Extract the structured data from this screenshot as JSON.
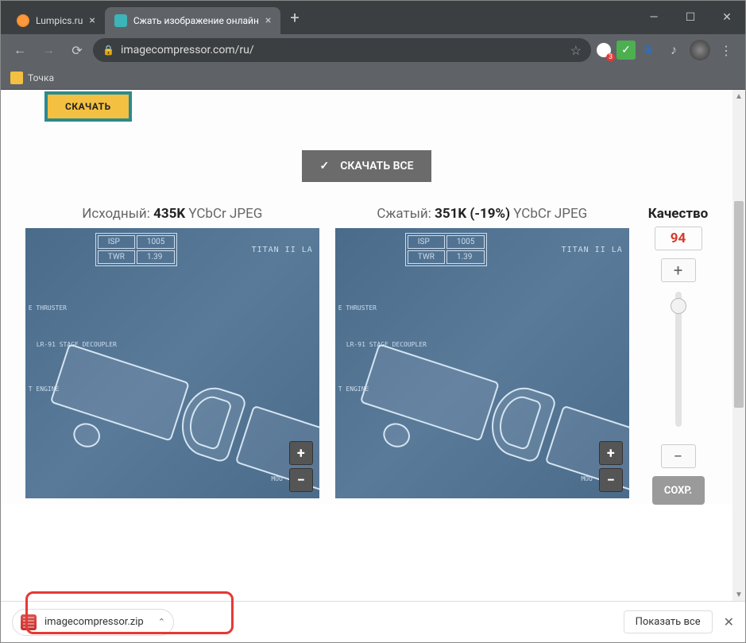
{
  "tabs": [
    {
      "title": "Lumpics.ru",
      "active": false
    },
    {
      "title": "Сжать изображение онлайн",
      "active": true
    }
  ],
  "address": {
    "url": "imagecompressor.com/ru/"
  },
  "bookmarks": [
    {
      "label": "Точка"
    }
  ],
  "page": {
    "download_single": "СКАЧАТЬ",
    "download_all": "СКАЧАТЬ ВСЕ",
    "original": {
      "prefix": "Исходный:",
      "size": "435K",
      "format": "YCbCr JPEG"
    },
    "compressed": {
      "prefix": "Сжатый:",
      "size": "351K",
      "delta": "(-19%)",
      "format": "YCbCr JPEG"
    },
    "blueprint": {
      "rows": [
        [
          "ISP",
          "1005"
        ],
        [
          "TWR",
          "1.39"
        ]
      ],
      "title": "TITAN II LA",
      "labels": {
        "thruster": "E THRUSTER",
        "decoupler": "LR-91 STAGE DECOUPLER",
        "engine": "T ENGINE",
        "mou": "MOU"
      }
    },
    "quality": {
      "title": "Качество",
      "value": "94",
      "plus": "+",
      "minus": "−",
      "save": "СОХР."
    },
    "zoom": {
      "in": "+",
      "out": "−"
    }
  },
  "downloads": {
    "item": "imagecompressor.zip",
    "show_all": "Показать все"
  }
}
